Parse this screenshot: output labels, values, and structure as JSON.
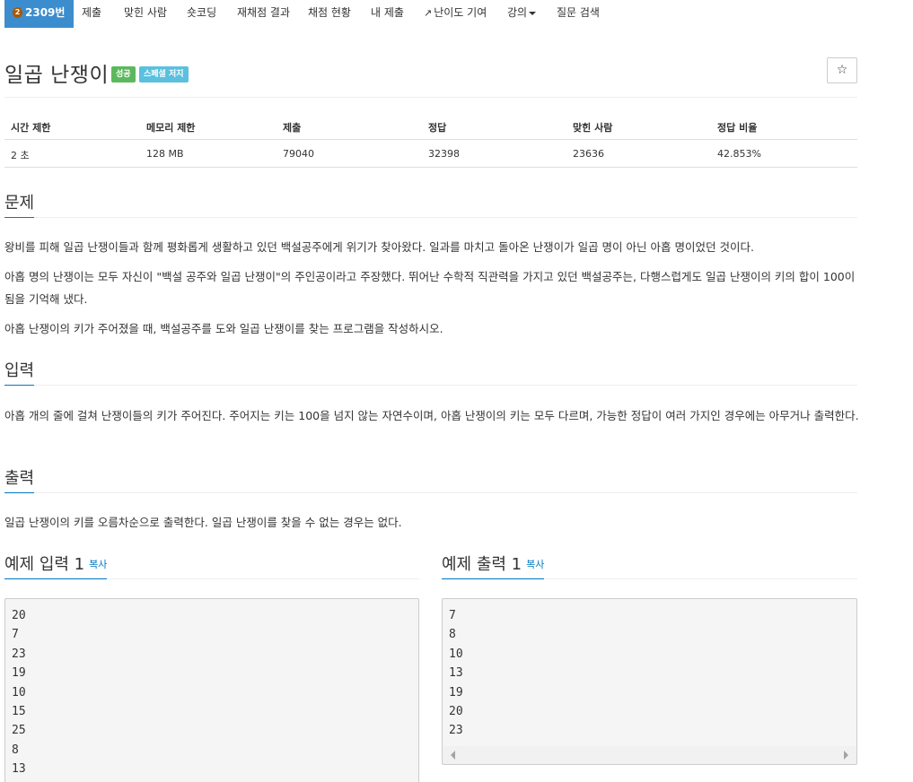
{
  "nav": {
    "problem_number": "2309번",
    "tier_badge": "2",
    "items": [
      "제출",
      "맞힌 사람",
      "숏코딩",
      "재채점 결과",
      "채점 현황",
      "내 제출",
      "난이도 기여",
      "강의",
      "질문 검색"
    ]
  },
  "problem": {
    "title": "일곱 난쟁이",
    "label_success": "성공",
    "label_special": "스페셜 저지",
    "star": "☆"
  },
  "stats": {
    "headers": [
      "시간 제한",
      "메모리 제한",
      "제출",
      "정답",
      "맞힌 사람",
      "정답 비율"
    ],
    "values": [
      "2 초",
      "128 MB",
      "79040",
      "32398",
      "23636",
      "42.853%"
    ]
  },
  "sections": {
    "description_title": "문제",
    "description": [
      "왕비를 피해 일곱 난쟁이들과 함께 평화롭게 생활하고 있던 백설공주에게 위기가 찾아왔다. 일과를 마치고 돌아온 난쟁이가 일곱 명이 아닌 아홉 명이었던 것이다.",
      "아홉 명의 난쟁이는 모두 자신이 \"백설 공주와 일곱 난쟁이\"의 주인공이라고 주장했다. 뛰어난 수학적 직관력을 가지고 있던 백설공주는, 다행스럽게도 일곱 난쟁이의 키의 합이 100이 됨을 기억해 냈다.",
      "아홉 난쟁이의 키가 주어졌을 때, 백설공주를 도와 일곱 난쟁이를 찾는 프로그램을 작성하시오."
    ],
    "input_title": "입력",
    "input": "아홉 개의 줄에 걸쳐 난쟁이들의 키가 주어진다. 주어지는 키는 100을 넘지 않는 자연수이며, 아홉 난쟁이의 키는 모두 다르며, 가능한 정답이 여러 가지인 경우에는 아무거나 출력한다.",
    "output_title": "출력",
    "output": "일곱 난쟁이의 키를 오름차순으로 출력한다. 일곱 난쟁이를 찾을 수 없는 경우는 없다."
  },
  "samples": {
    "input_title": "예제 입력 1",
    "output_title": "예제 출력 1",
    "copy_label": "복사",
    "input_lines": [
      "20",
      "7",
      "23",
      "19",
      "10",
      "15",
      "25",
      "8",
      "13"
    ],
    "output_lines": [
      "7",
      "8",
      "10",
      "13",
      "19",
      "20",
      "23"
    ]
  }
}
